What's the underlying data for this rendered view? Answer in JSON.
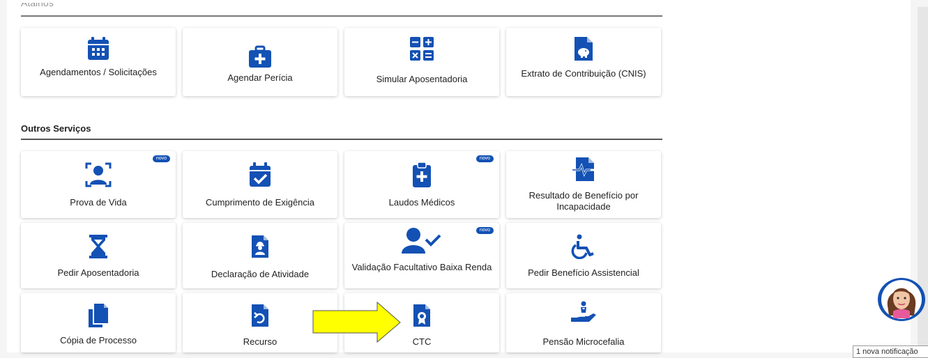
{
  "top_section": {
    "partial_title": "Atalhos"
  },
  "shortcuts": [
    {
      "label": "Agendamentos / Solicitações",
      "icon": "calendar-grid-icon"
    },
    {
      "label": "Agendar Perícia",
      "icon": "medical-bag-icon"
    },
    {
      "label": "Simular Aposentadoria",
      "icon": "calculator-icon"
    },
    {
      "label": "Extrato de Contribuição (CNIS)",
      "icon": "piggy-bank-document-icon"
    }
  ],
  "other_services": {
    "title": "Outros Serviços",
    "badge_text": "novo",
    "items": [
      {
        "label": "Prova de Vida",
        "icon": "face-scan-icon",
        "badge": true
      },
      {
        "label": "Cumprimento de Exigência",
        "icon": "calendar-check-icon",
        "badge": false
      },
      {
        "label": "Laudos Médicos",
        "icon": "medical-clipboard-icon",
        "badge": true
      },
      {
        "label": "Resultado de Benefício por Incapacidade",
        "icon": "pulse-document-icon",
        "badge": false
      },
      {
        "label": "Pedir Aposentadoria",
        "icon": "hourglass-icon",
        "badge": false
      },
      {
        "label": "Declaração de Atividade",
        "icon": "worker-document-icon",
        "badge": false
      },
      {
        "label": "Validação Facultativo Baixa Renda",
        "icon": "user-check-icon",
        "badge": true
      },
      {
        "label": "Pedir Benefício Assistencial",
        "icon": "wheelchair-icon",
        "badge": false
      },
      {
        "label": "Cópia de Processo",
        "icon": "copy-documents-icon",
        "badge": false
      },
      {
        "label": "Recurso",
        "icon": "undo-document-icon",
        "badge": false
      },
      {
        "label": "CTC",
        "icon": "certificate-document-icon",
        "badge": false
      },
      {
        "label": "Pensão Microcefalia",
        "icon": "baby-hand-icon",
        "badge": false
      }
    ]
  },
  "notification": {
    "text": "1 nova notificação"
  },
  "colors": {
    "accent": "#1351b4",
    "arrow": "#ffff00"
  }
}
